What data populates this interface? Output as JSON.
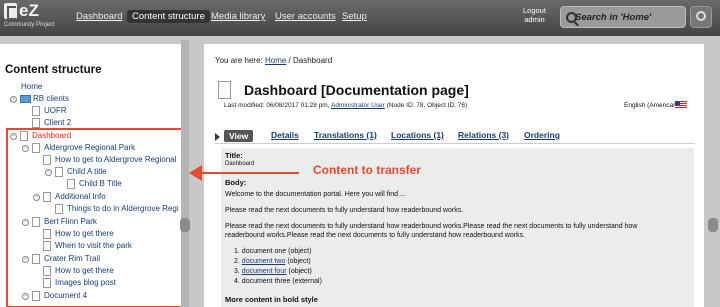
{
  "header": {
    "logo_text": "eZ",
    "logo_sub": "Community Project",
    "nav": [
      "Dashboard",
      "Content structure",
      "Media library",
      "User accounts",
      "Setup"
    ],
    "active_nav": "Content structure",
    "logout_label": "Logout",
    "user": "admin",
    "search_placeholder": "Search in 'Home'"
  },
  "sidebar": {
    "title": "Content structure",
    "tree": [
      {
        "label": "Home",
        "icon": "page"
      },
      {
        "label": "RB clients",
        "icon": "folder"
      },
      {
        "label": "UOFR",
        "icon": "page"
      },
      {
        "label": "Client 2",
        "icon": "page"
      },
      {
        "label": "Dashboard",
        "icon": "page",
        "highlight": "#d62b16"
      },
      {
        "label": "Aldergrove Regional Park",
        "icon": "page"
      },
      {
        "label": "How to get to Aldergrove Regional",
        "icon": "page"
      },
      {
        "label": "Child A title",
        "icon": "page"
      },
      {
        "label": "Child B Title",
        "icon": "page"
      },
      {
        "label": "Additional Info",
        "icon": "page"
      },
      {
        "label": "Things to do in Aldergrove Regi",
        "icon": "page"
      },
      {
        "label": "Bert Flinn Park",
        "icon": "page"
      },
      {
        "label": "How to get there",
        "icon": "page"
      },
      {
        "label": "When to visit the park",
        "icon": "page"
      },
      {
        "label": "Crater Rim Trail",
        "icon": "page"
      },
      {
        "label": "How to get there",
        "icon": "page"
      },
      {
        "label": "Images blog post",
        "icon": "page"
      },
      {
        "label": "Document 4",
        "icon": "page"
      }
    ]
  },
  "annotation": {
    "callout_text": "Content to transfer",
    "color": "#e84a2f"
  },
  "main": {
    "breadcrumb_prefix": "You are here:",
    "breadcrumb_home": "Home",
    "breadcrumb_sep": " / ",
    "breadcrumb_current": "Dashboard",
    "title": "Dashboard [Documentation page]",
    "meta_prefix": "Last modified: 06/08/2017 01:28 pm,",
    "meta_user": "Administrator User",
    "meta_suffix": "(Node ID: 78, Object ID: 76)",
    "language": "English (American)",
    "tabs": [
      "View",
      "Details",
      "Translations (1)",
      "Locations (1)",
      "Relations (3)",
      "Ordering"
    ],
    "active_tab": "View",
    "content": {
      "title_label": "Title:",
      "title_value": "Dashboard",
      "body_label": "Body:",
      "p1": "Welcome to the documentation portal. Here you will find ...",
      "p2": "Please read the next documents to fully understand how readerbound works.",
      "p3a": "Please read the next documents to fully understand how readerbound works.Please read the next documents to fully understand how",
      "p3b": "readerbound works.Please read the next documents to fully understand how readerbound works.",
      "list": [
        "document one (object)",
        "document two",
        "document four",
        "document three (external)"
      ],
      "list_suffix_2": " (object)",
      "list_suffix_3": " (object)",
      "more_label": "More content in bold style"
    }
  }
}
